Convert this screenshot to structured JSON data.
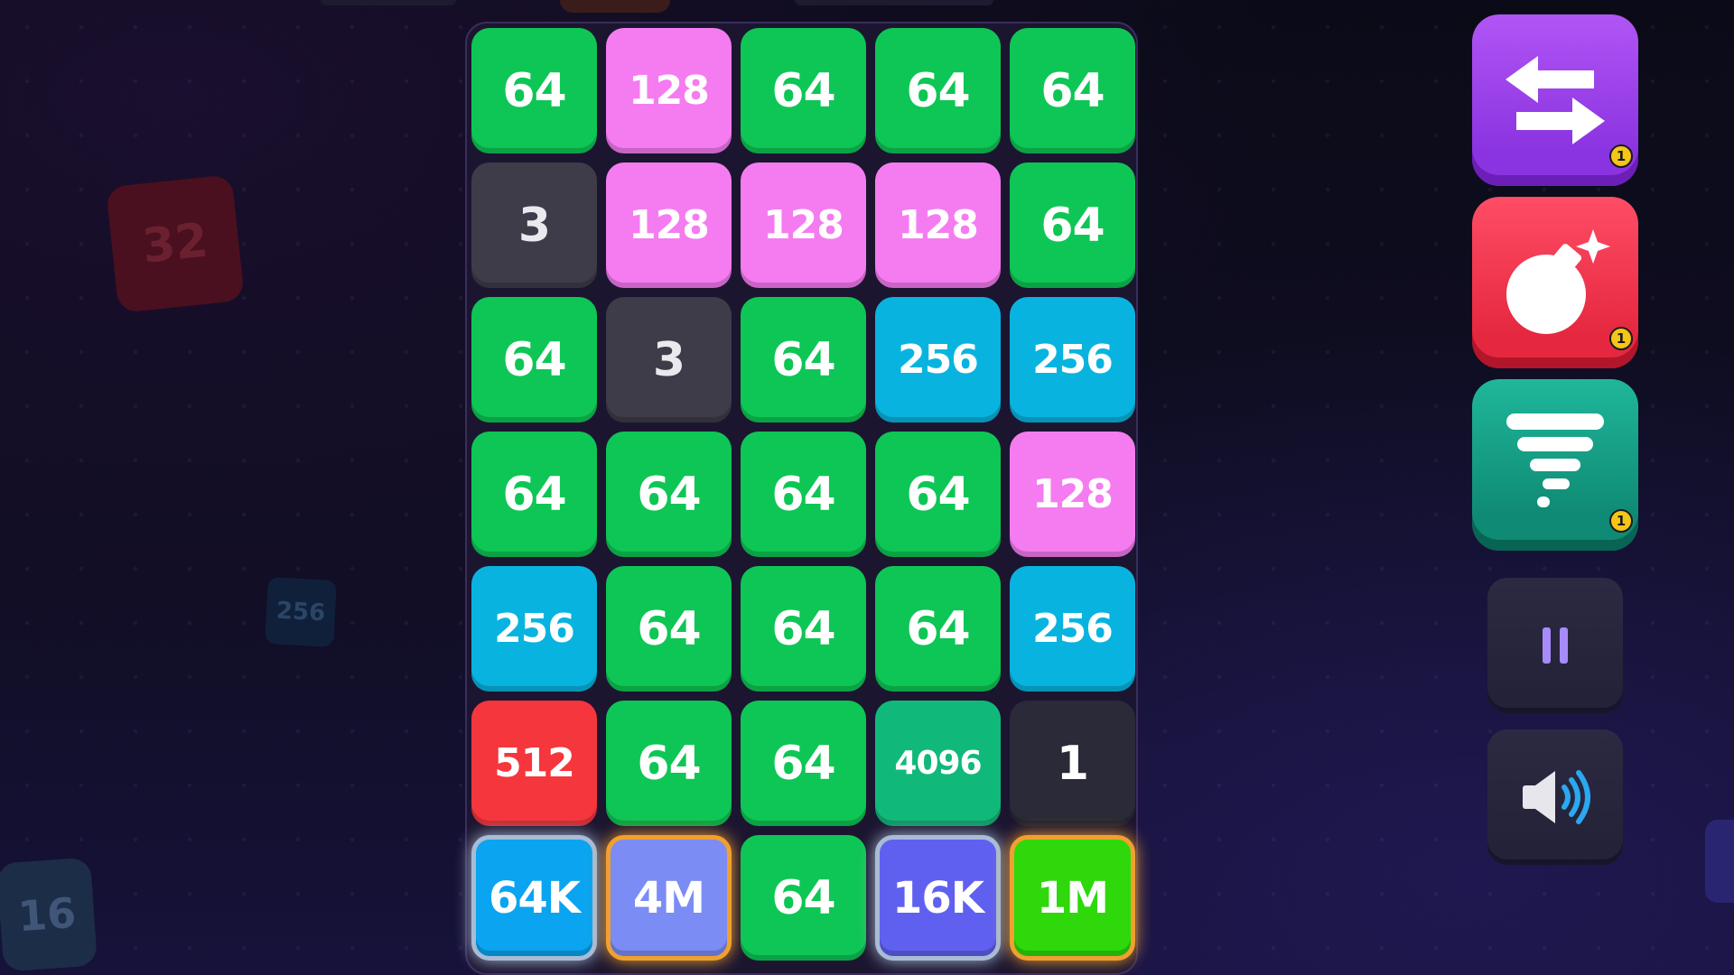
{
  "background_tiles": [
    {
      "id": "bg-tile-32",
      "label": "32"
    },
    {
      "id": "bg-tile-256",
      "label": "256"
    },
    {
      "id": "bg-tile-16",
      "label": "16"
    }
  ],
  "board": {
    "columns": 5,
    "rows": 7,
    "tiles": [
      [
        "64",
        "128",
        "64",
        "64",
        "64"
      ],
      [
        "3",
        "128",
        "128",
        "128",
        "64"
      ],
      [
        "64",
        "3",
        "64",
        "256",
        "256"
      ],
      [
        "64",
        "64",
        "64",
        "64",
        "128"
      ],
      [
        "256",
        "64",
        "64",
        "64",
        "256"
      ],
      [
        "512",
        "64",
        "64",
        "4096",
        "1"
      ],
      [
        "64K",
        "4M",
        "64",
        "16K",
        "1M"
      ]
    ]
  },
  "tile_colors": {
    "1": "#2a2a38",
    "3": "#3d3c48",
    "64": "#0ec655",
    "128": "#f57cf0",
    "256": "#08b4df",
    "512": "#f5363c",
    "4096": "#10b97a",
    "16K": "#6060f0",
    "64K": "#0aa4f0",
    "1M": "#2ed80a",
    "4M": "#7b8cf5"
  },
  "glow_tiles": {
    "64K": "#a8bcd6",
    "4M": "#f0a030",
    "16K": "#a8bcd6",
    "1M": "#f0a030"
  },
  "powerups": {
    "swap": {
      "icon": "swap-arrows-icon",
      "count": "1",
      "color": "#9b44eb"
    },
    "bomb": {
      "icon": "bomb-icon",
      "count": "1",
      "color": "#f0334d"
    },
    "tornado": {
      "icon": "tornado-icon",
      "count": "1",
      "color": "#16a085"
    }
  },
  "controls": {
    "pause": {
      "icon": "pause-icon"
    },
    "sound": {
      "icon": "speaker-on-icon"
    }
  }
}
